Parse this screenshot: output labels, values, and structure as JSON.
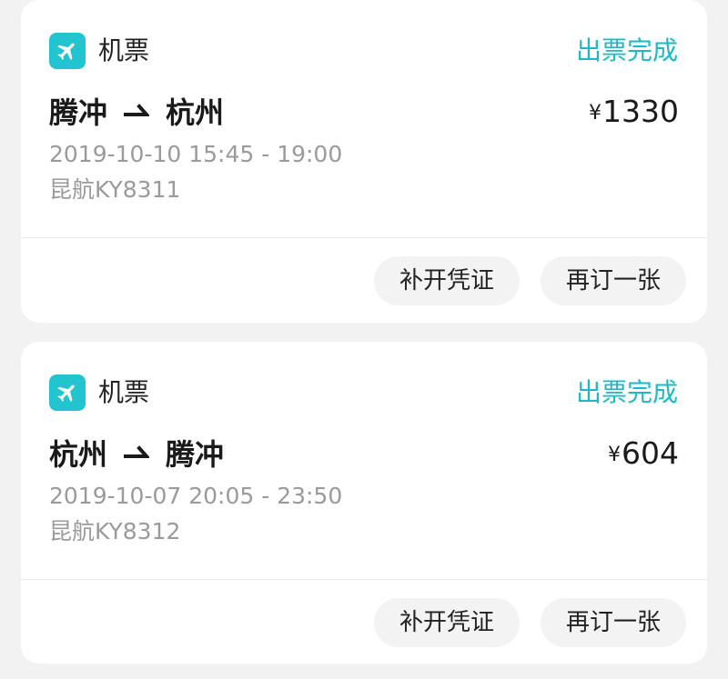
{
  "orders": [
    {
      "category": "机票",
      "category_icon": "airplane-icon",
      "status": "出票完成",
      "origin": "腾冲",
      "destination": "杭州",
      "currency": "¥",
      "amount": "1330",
      "datetime": "2019-10-10 15:45 - 19:00",
      "flight": "昆航KY8311",
      "actions": {
        "voucher": "补开凭证",
        "rebook": "再订一张"
      }
    },
    {
      "category": "机票",
      "category_icon": "airplane-icon",
      "status": "出票完成",
      "origin": "杭州",
      "destination": "腾冲",
      "currency": "¥",
      "amount": "604",
      "datetime": "2019-10-07 20:05 - 23:50",
      "flight": "昆航KY8312",
      "actions": {
        "voucher": "补开凭证",
        "rebook": "再订一张"
      }
    }
  ],
  "colors": {
    "accent": "#22c5cf",
    "status": "#1eb8c6",
    "muted_text": "#9a9a9a",
    "background": "#f2f2f2"
  }
}
